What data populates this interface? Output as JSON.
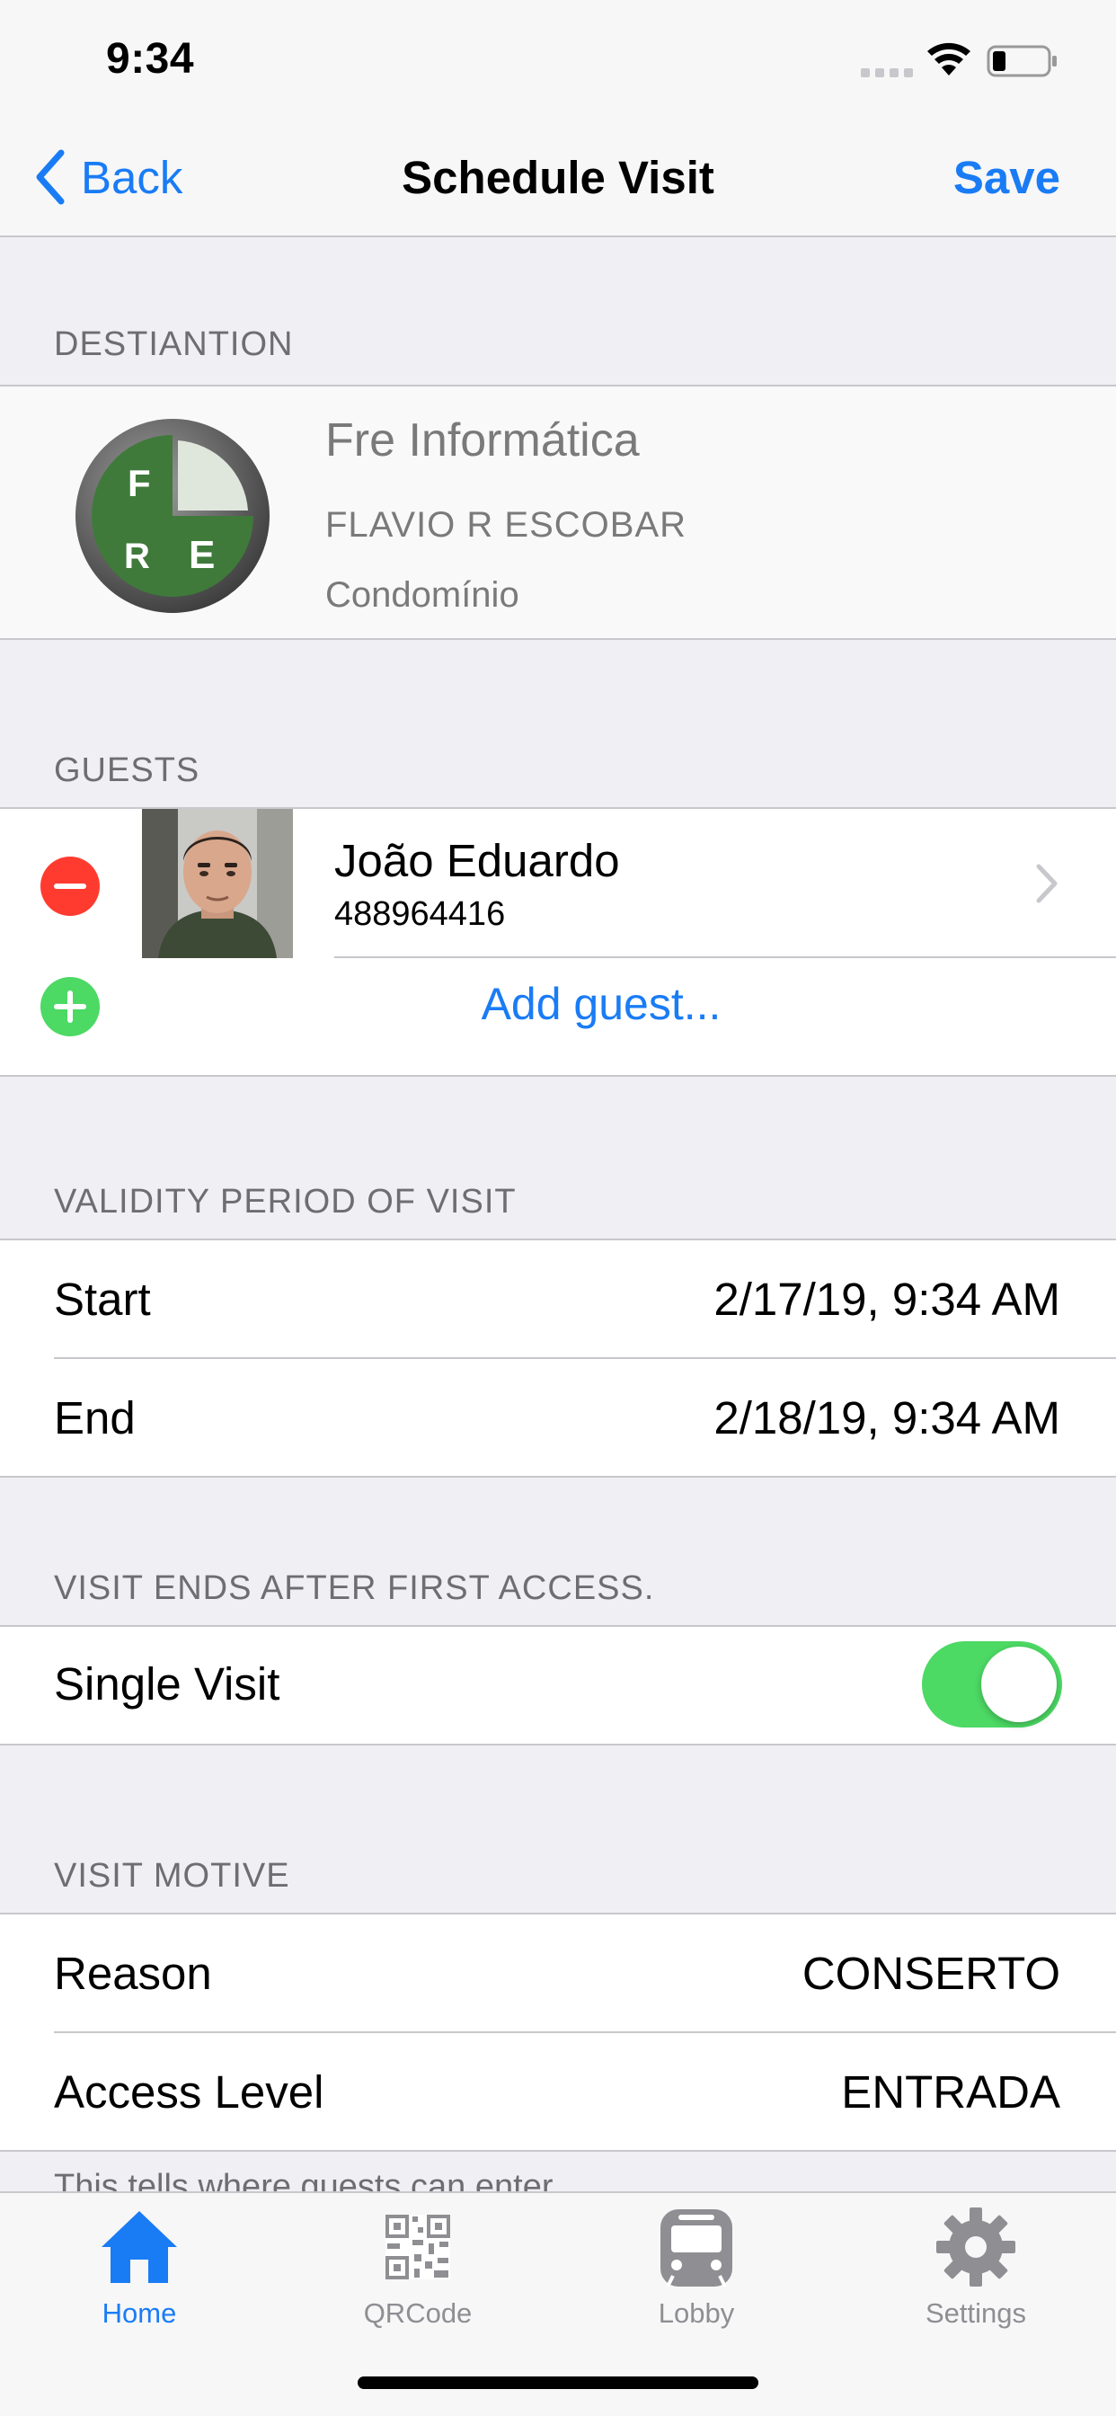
{
  "status_bar": {
    "time": "9:34"
  },
  "nav": {
    "back_label": "Back",
    "title": "Schedule Visit",
    "save_label": "Save"
  },
  "destination": {
    "header": "DESTIANTION",
    "name": "Fre Informática",
    "owner": "FLAVIO R ESCOBAR",
    "type": "Condomínio"
  },
  "guests": {
    "header": "GUESTS",
    "items": [
      {
        "name": "João Eduardo",
        "id": "488964416"
      }
    ],
    "add_label": "Add guest..."
  },
  "validity": {
    "header": "VALIDITY PERIOD OF VISIT",
    "start_label": "Start",
    "start_value": "2/17/19, 9:34 AM",
    "end_label": "End",
    "end_value": "2/18/19, 9:34 AM"
  },
  "single_visit": {
    "header": "VISIT ENDS AFTER FIRST ACCESS.",
    "label": "Single Visit",
    "enabled": true
  },
  "motive": {
    "header": "VISIT MOTIVE",
    "reason_label": "Reason",
    "reason_value": "CONSERTO",
    "access_label": "Access Level",
    "access_value": "ENTRADA",
    "footer_note": "This tells where guests can enter"
  },
  "tab_bar": {
    "tabs": [
      {
        "label": "Home",
        "icon": "home-icon",
        "active": true
      },
      {
        "label": "QRCode",
        "icon": "qrcode-icon",
        "active": false
      },
      {
        "label": "Lobby",
        "icon": "bus-icon",
        "active": false
      },
      {
        "label": "Settings",
        "icon": "gear-icon",
        "active": false
      }
    ]
  },
  "colors": {
    "accent": "#1a7cf5",
    "toggle_on": "#4cd964",
    "remove": "#ff3b30",
    "add": "#4cd964"
  }
}
